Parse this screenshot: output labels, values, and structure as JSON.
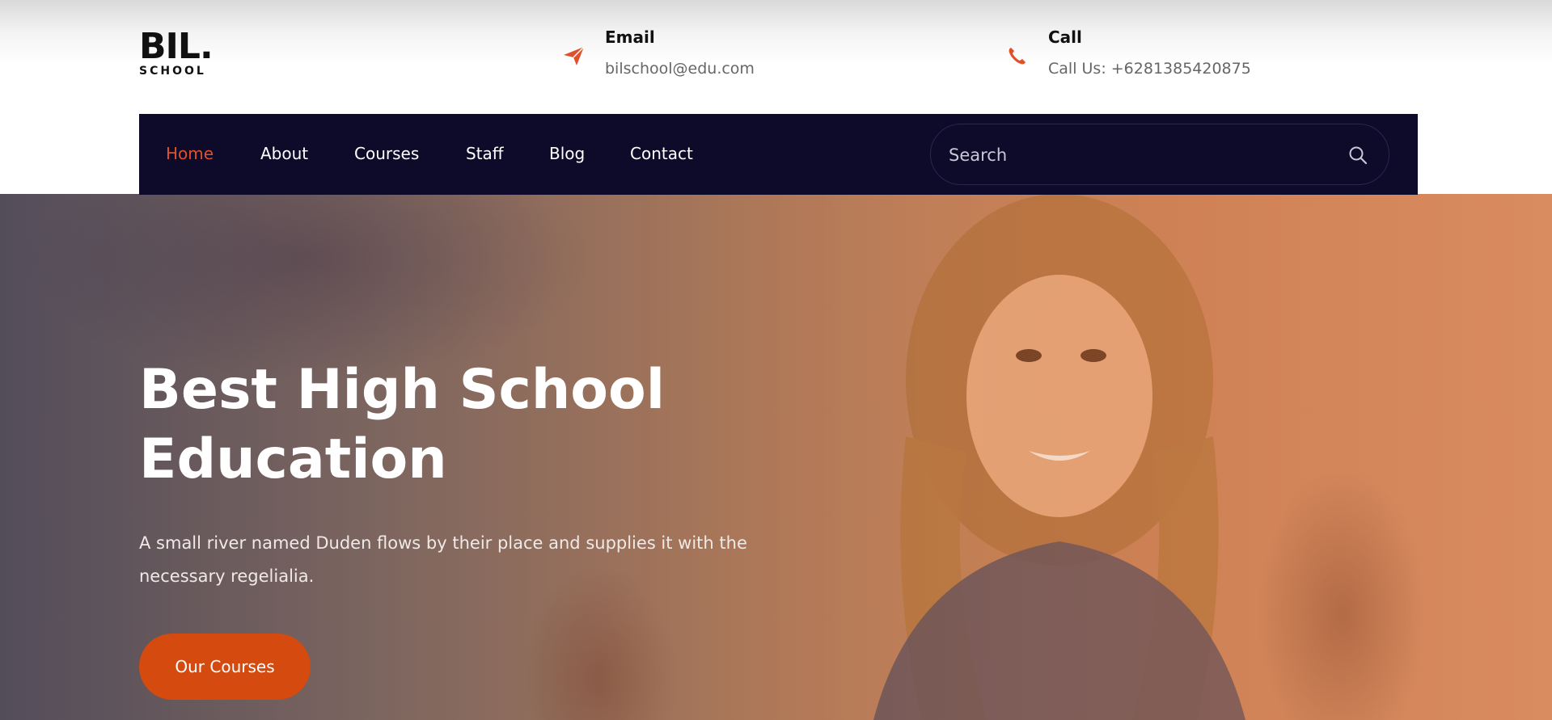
{
  "logo": {
    "main": "BIL.",
    "sub": "SCHOOL"
  },
  "header": {
    "email": {
      "title": "Email",
      "value": "bilschool@edu.com",
      "icon": "paper-plane-icon"
    },
    "call": {
      "title": "Call",
      "value": "Call Us: +6281385420875",
      "icon": "phone-icon"
    }
  },
  "nav": {
    "items": [
      {
        "label": "Home",
        "active": true
      },
      {
        "label": "About"
      },
      {
        "label": "Courses"
      },
      {
        "label": "Staff"
      },
      {
        "label": "Blog"
      },
      {
        "label": "Contact"
      }
    ],
    "search": {
      "placeholder": "Search",
      "icon": "search-icon"
    }
  },
  "hero": {
    "title_line1": "Best High School",
    "title_line2": "Education",
    "text": "A small river named Duden flows by their place and supplies it with the necessary regelialia.",
    "button": "Our Courses"
  },
  "colors": {
    "accent": "#d44a0f",
    "nav_bg": "#0e0a2a",
    "active_nav": "#e0512b"
  }
}
